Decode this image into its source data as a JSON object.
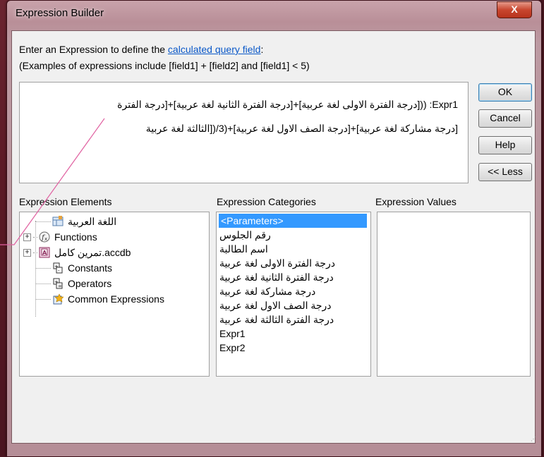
{
  "window": {
    "title": "Expression Builder",
    "close_glyph": "X"
  },
  "intro": {
    "prefix": "Enter an Expression to define the ",
    "link": "calculated query field",
    "suffix": ":"
  },
  "examples": "(Examples of expressions include [field1] + [field2] and [field1] < 5)",
  "expression": {
    "line1": "Expr1: (([درجة الفترة الاولى لغة عربية]+[درجة الفترة الثانية  لغة عربية]+[درجة الفترة",
    "line2": "[درجة مشاركة  لغة عربية]+[درجة الصف الاول  لغة عربية]+(3/([الثالثة  لغة عربية"
  },
  "buttons": {
    "ok": "OK",
    "cancel": "Cancel",
    "help": "Help",
    "less": "<< Less"
  },
  "panels": {
    "elements_label": "Expression Elements",
    "categories_label": "Expression Categories",
    "values_label": "Expression Values"
  },
  "elements": [
    {
      "label": "اللغة العربية",
      "icon": "query-icon",
      "expander": ""
    },
    {
      "label": "Functions",
      "icon": "functions-icon",
      "expander": "+"
    },
    {
      "label": "تمرين كامل.accdb",
      "icon": "database-icon",
      "expander": "+"
    },
    {
      "label": "Constants",
      "icon": "constants-icon",
      "expander": ""
    },
    {
      "label": "Operators",
      "icon": "operators-icon",
      "expander": ""
    },
    {
      "label": "Common Expressions",
      "icon": "common-expressions-icon",
      "expander": ""
    }
  ],
  "categories": [
    "<Parameters>",
    "رقم الجلوس",
    "اسم الطالبة",
    "درجة الفترة الاولى لغة عربية",
    "درجة الفترة الثانية  لغة عربية",
    "درجة مشاركة  لغة عربية",
    "درجة الصف الاول  لغة عربية",
    "درجة الفترة الثالثة  لغة عربية",
    "Expr1",
    "Expr2"
  ],
  "colors": {
    "selection": "#3399ff",
    "link": "#0a58c8",
    "annotation_line": "#e060a0"
  }
}
